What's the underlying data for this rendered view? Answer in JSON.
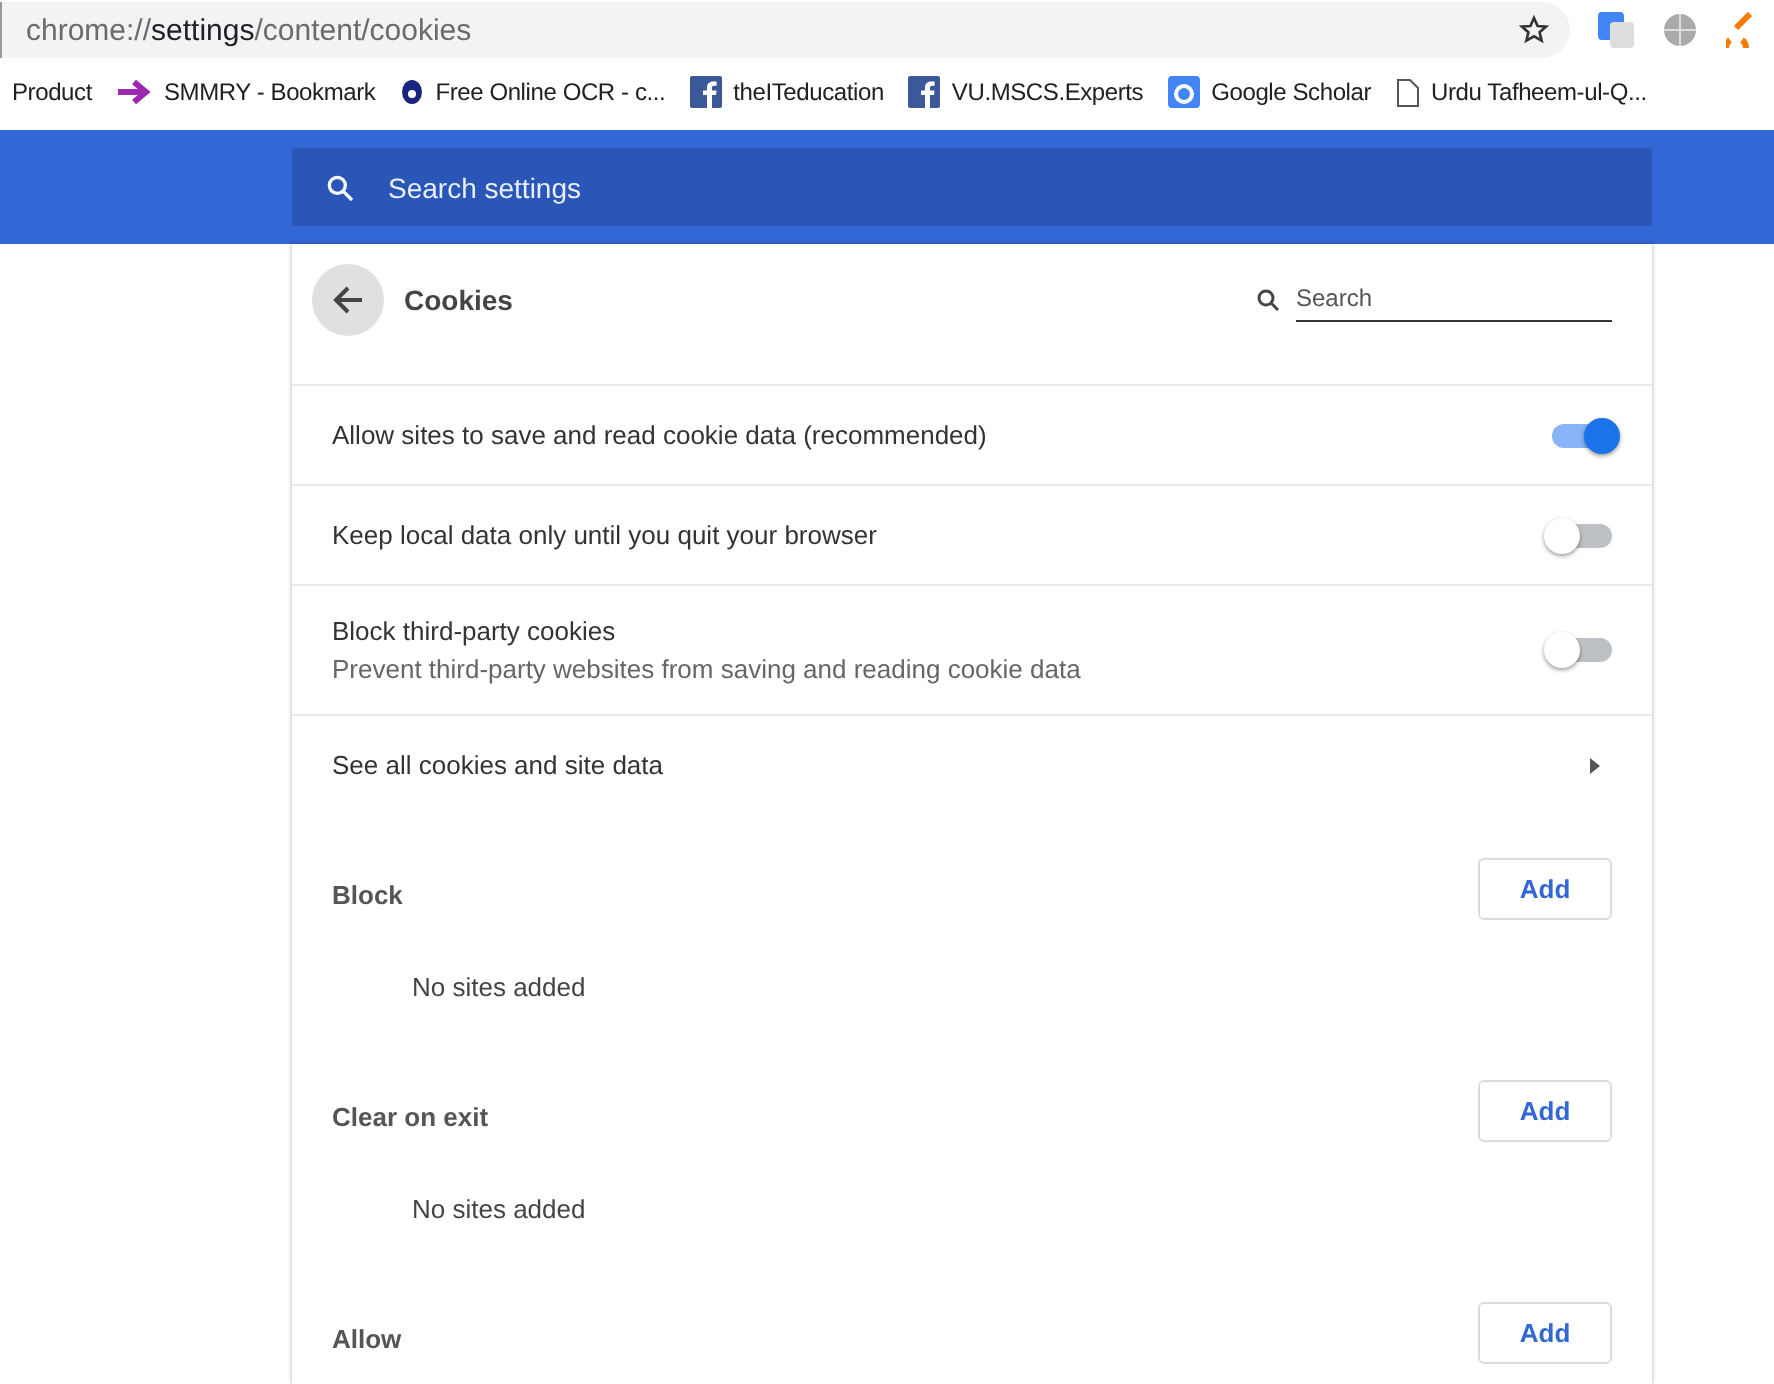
{
  "address_bar": {
    "scheme": "chrome://",
    "host": "settings",
    "path": "/content/cookies"
  },
  "bookmarks": [
    {
      "label": "Product",
      "kind": "none"
    },
    {
      "label": "SMMRY - Bookmark",
      "kind": "arrow"
    },
    {
      "label": "Free Online OCR - c...",
      "kind": "ocr"
    },
    {
      "label": "theITeducation",
      "kind": "facebook"
    },
    {
      "label": "VU.MSCS.Experts",
      "kind": "facebook"
    },
    {
      "label": "Google Scholar",
      "kind": "scholar"
    },
    {
      "label": "Urdu Tafheem-ul-Q...",
      "kind": "page"
    }
  ],
  "search_settings": {
    "placeholder": "Search settings"
  },
  "page": {
    "title": "Cookies",
    "search": {
      "placeholder": "Search"
    }
  },
  "rows": [
    {
      "kind": "toggle",
      "label": "Allow sites to save and read cookie data (recommended)",
      "on": true
    },
    {
      "kind": "toggle",
      "label": "Keep local data only until you quit your browser",
      "on": false
    },
    {
      "kind": "toggle",
      "label": "Block third-party cookies",
      "description": "Prevent third-party websites from saving and reading cookie data",
      "on": false
    },
    {
      "kind": "link",
      "label": "See all cookies and site data"
    }
  ],
  "sections": [
    {
      "title": "Block",
      "button": "Add",
      "empty": "No sites added"
    },
    {
      "title": "Clear on exit",
      "button": "Add",
      "empty": "No sites added"
    },
    {
      "title": "Allow",
      "button": "Add"
    }
  ]
}
